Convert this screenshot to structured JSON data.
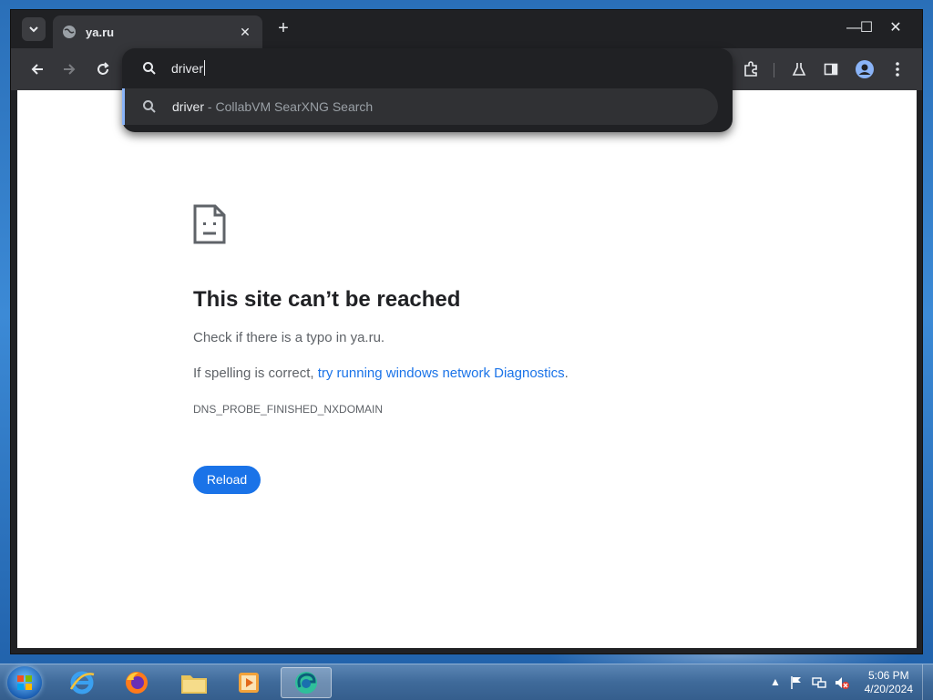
{
  "browser": {
    "tab_title": "ya.ru",
    "tab_close": "✕",
    "new_tab": "+",
    "window_controls": [
      "—",
      "☐",
      "✕"
    ]
  },
  "omnibox": {
    "input_value": "driver",
    "suggestion_query": "driver",
    "suggestion_source": " - CollabVM SearXNG Search"
  },
  "error_page": {
    "title": "This site can’t be reached",
    "line1": "Check if there is a typo in ya.ru.",
    "line2_prefix": "If spelling is correct, ",
    "line2_link": "try running windows network Diagnostics",
    "line2_suffix": ".",
    "error_code": "DNS_PROBE_FINISHED_NXDOMAIN",
    "reload_label": "Reload"
  },
  "taskbar": {
    "time": "5:06 PM",
    "date": "4/20/2024"
  },
  "colors": {
    "link": "#1a73e8",
    "button": "#1a73e8",
    "chrome_dark": "#202124",
    "toolbar": "#35363a"
  }
}
